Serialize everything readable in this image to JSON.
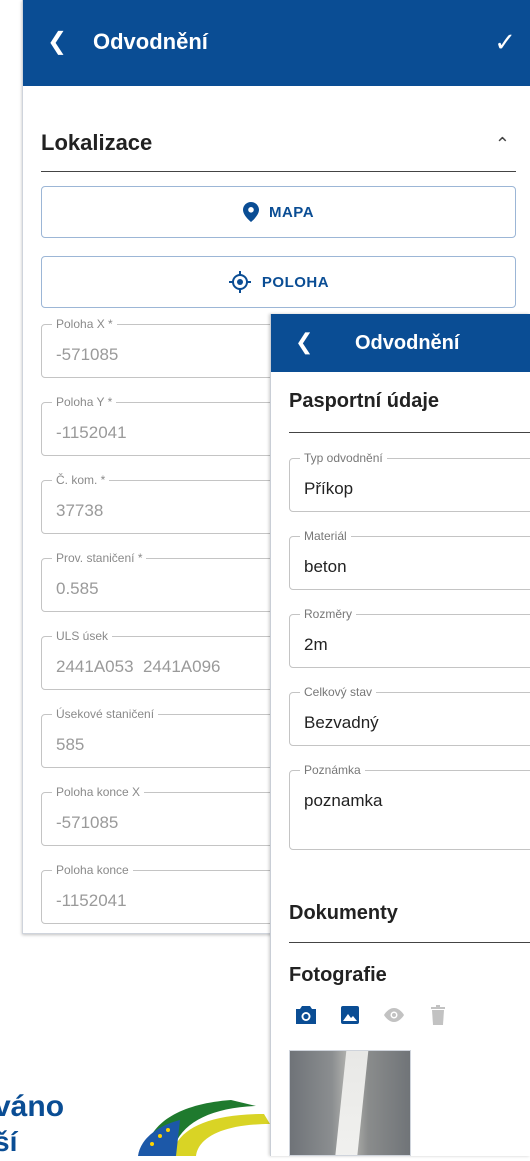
{
  "back_panel": {
    "header": {
      "title": "Odvodnění",
      "back_icon": "chevron-left-icon",
      "confirm_icon": "check-icon"
    },
    "section": {
      "title": "Lokalizace",
      "toggle_icon": "chevron-up-icon"
    },
    "buttons": {
      "map": {
        "label": "MAPA",
        "icon": "map-pin-icon"
      },
      "position": {
        "label": "POLOHA",
        "icon": "crosshair-icon"
      }
    },
    "fields": [
      {
        "label": "Poloha X *",
        "value": "-571085"
      },
      {
        "label": "Poloha Y *",
        "value": "-1152041"
      },
      {
        "label": "Č. kom. *",
        "value": "37738"
      },
      {
        "label": "Prov. staničení *",
        "value": "0.585"
      },
      {
        "label": "ULS úsek",
        "value": "2441A053  2441A096"
      },
      {
        "label": "Úsekové staničení",
        "value": "585"
      },
      {
        "label": "Poloha konce X",
        "value": "-571085"
      },
      {
        "label": "Poloha konce",
        "value": "-1152041"
      }
    ]
  },
  "front_panel": {
    "header": {
      "title": "Odvodnění",
      "back_icon": "chevron-left-icon"
    },
    "section_pasport": "Pasportní údaje",
    "fields": [
      {
        "label": "Typ odvodnění",
        "value": "Příkop"
      },
      {
        "label": "Materiál",
        "value": "beton"
      },
      {
        "label": "Rozměry",
        "value": "2m"
      },
      {
        "label": "Celkový stav",
        "value": "Bezvadný"
      },
      {
        "label": "Poznámka",
        "value": "poznamka"
      }
    ],
    "section_documents": "Dokumenty",
    "section_photos": "Fotografie",
    "photo_tools": [
      "camera-icon",
      "image-icon",
      "eye-icon",
      "trash-icon"
    ]
  },
  "branding": {
    "line1": "váno",
    "line2": "ší"
  },
  "colors": {
    "primary": "#0a4d94",
    "disabled": "#b8b8b8"
  }
}
